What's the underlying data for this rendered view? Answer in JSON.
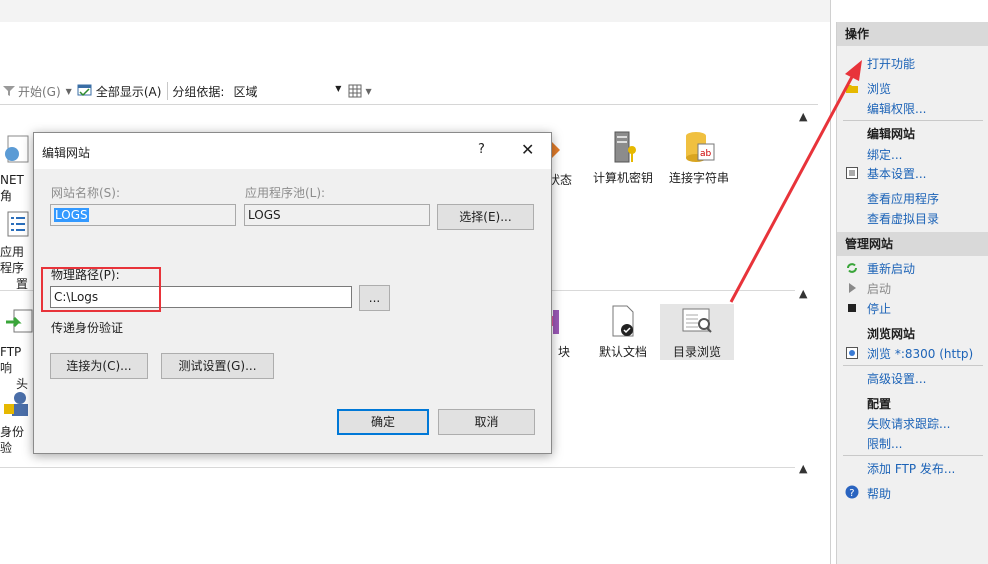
{
  "toolbar": {
    "start": "开始(G)",
    "show_all": "全部显示(A)",
    "group_by": "分组依据:",
    "group_value": "区域"
  },
  "features_row1": [
    {
      "label": "NET 角",
      "icon": "globe-icon"
    },
    {
      "label": "状态",
      "icon": "diamond-icon"
    },
    {
      "label": "计算机密钥",
      "icon": "key-server-icon"
    },
    {
      "label": "连接字符串",
      "icon": "db-ab-icon"
    }
  ],
  "features_row1b": {
    "line1": "应用程序",
    "line2": "置"
  },
  "features_row2": [
    {
      "line1": "FTP 响",
      "line2": "头",
      "icon": "ftp-icon"
    },
    {
      "label": "块",
      "icon": "module-icon"
    },
    {
      "label": "默认文档",
      "icon": "default-doc-icon"
    },
    {
      "label": "目录浏览",
      "icon": "dir-browse-icon"
    }
  ],
  "features_row3": {
    "label": "身份验",
    "icon": "user-lock-icon"
  },
  "actions": {
    "title": "操作",
    "open_feature": "打开功能",
    "browse": "浏览",
    "edit_perm": "编辑权限...",
    "edit_site_head": "编辑网站",
    "bind": "绑定...",
    "basic_settings": "基本设置...",
    "view_apps": "查看应用程序",
    "view_vdirs": "查看虚拟目录",
    "manage_head": "管理网站",
    "restart": "重新启动",
    "start": "启动",
    "stop": "停止",
    "browse_head": "浏览网站",
    "browse_url": "浏览 *:8300 (http)",
    "advanced": "高级设置...",
    "config_head": "配置",
    "failed_req": "失败请求跟踪...",
    "limits": "限制...",
    "add_ftp": "添加 FTP 发布...",
    "help": "帮助"
  },
  "dialog": {
    "title": "编辑网站",
    "help": "?",
    "close": "✕",
    "site_name_label": "网站名称(S):",
    "site_name_value": "LOGS",
    "app_pool_label": "应用程序池(L):",
    "app_pool_value": "LOGS",
    "select_btn": "选择(E)...",
    "phys_path_label": "物理路径(P):",
    "phys_path_value": "C:\\Logs",
    "browse_btn": "...",
    "pass_auth": "传递身份验证",
    "connect_as": "连接为(C)...",
    "test_settings": "测试设置(G)...",
    "ok": "确定",
    "cancel": "取消"
  },
  "colors": {
    "accent": "#0078d7",
    "link": "#1c63b7",
    "highlight": "#e8333a"
  }
}
